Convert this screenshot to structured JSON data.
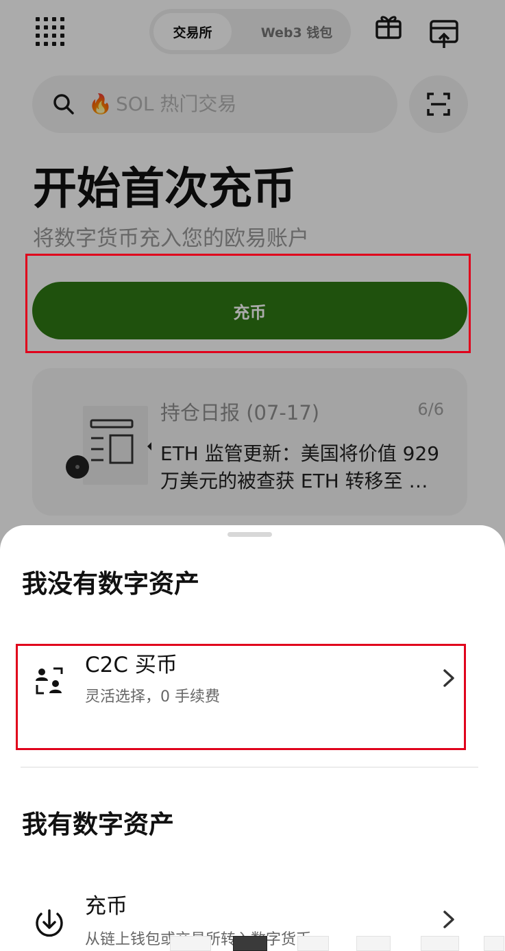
{
  "header": {
    "tab_active": "交易所",
    "tab_other": "Web3 钱包"
  },
  "search": {
    "placeholder_icon": "🔥",
    "placeholder": "SOL 热门交易"
  },
  "hero": {
    "title": "开始首次充币",
    "subtitle": "将数字货币充入您的欧易账户",
    "button_label": "充币"
  },
  "news": {
    "title": "持仓日报 (07-17)",
    "page": "6/6",
    "body": "ETH 监管更新：美国将价值 929 万美元的被查获 ETH 转移至 …"
  },
  "sheet": {
    "section_no_assets": "我没有数字资产",
    "c2c_title": "C2C 买币",
    "c2c_desc": "灵活选择，0 手续费",
    "section_has_assets": "我有数字资产",
    "deposit_title": "充币",
    "deposit_desc": "从链上钱包或交易所转入数字货币"
  },
  "colors": {
    "accent_green": "#2f7a14",
    "highlight_red": "#e0001b"
  },
  "icons": {
    "menu": "grid-menu-icon",
    "gift": "gift-icon",
    "topup": "upload-tray-icon",
    "search": "search-icon",
    "scan": "scan-icon",
    "c2c": "users-exchange-icon",
    "deposit": "download-circle-icon",
    "chevron": "chevron-right-icon"
  }
}
